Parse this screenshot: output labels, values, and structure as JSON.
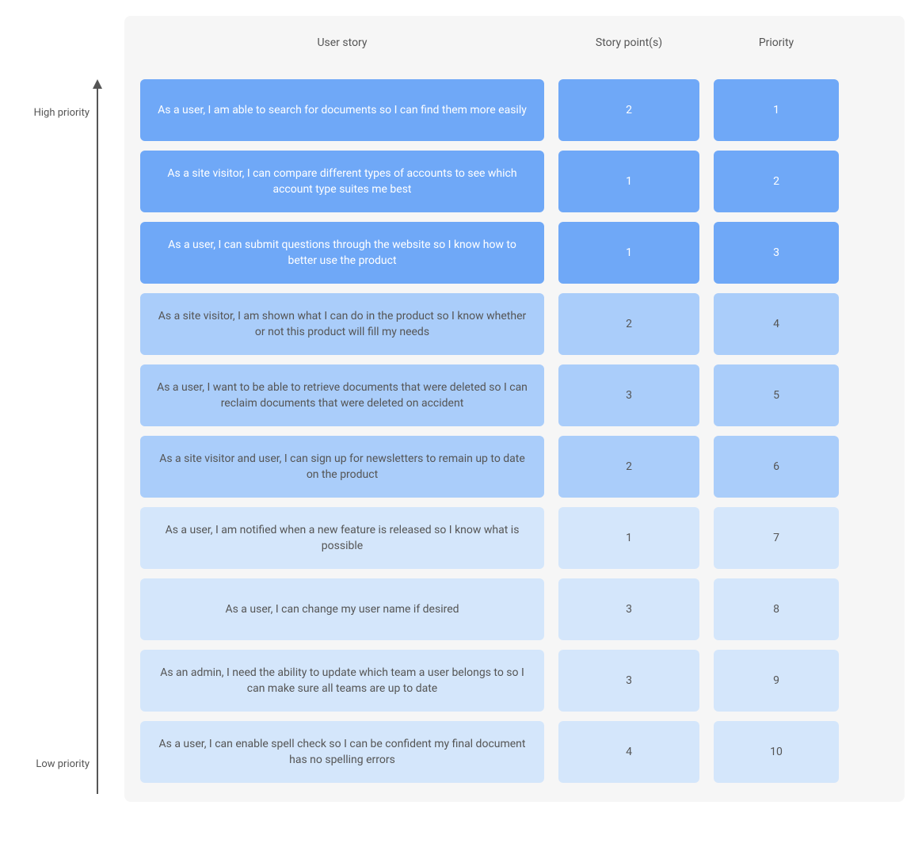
{
  "axis": {
    "high_label": "High priority",
    "low_label": "Low priority"
  },
  "headers": {
    "story": "User story",
    "points": "Story point(s)",
    "priority": "Priority"
  },
  "colors": {
    "tier_high": "#6fa8f7",
    "tier_mid": "#aacdfa",
    "tier_low": "#d4e6fb",
    "panel_bg": "#f6f6f6"
  },
  "rows": [
    {
      "story": "As a user, I am able to search for documents so I can find them more easily",
      "points": "2",
      "priority": "1",
      "tier": "high"
    },
    {
      "story": "As a site visitor, I can compare different types of accounts to see which account type suites me best",
      "points": "1",
      "priority": "2",
      "tier": "high"
    },
    {
      "story": "As a user, I can submit questions through the website so I know how to better use the product",
      "points": "1",
      "priority": "3",
      "tier": "high"
    },
    {
      "story": "As a site visitor, I am shown what I can do in the product so I know whether or not this product will fill my needs",
      "points": "2",
      "priority": "4",
      "tier": "mid"
    },
    {
      "story": "As a user, I want to be able to retrieve documents that were deleted so I can reclaim documents that were deleted on accident",
      "points": "3",
      "priority": "5",
      "tier": "mid"
    },
    {
      "story": "As a site visitor and user, I can sign up for newsletters to remain up to date on the product",
      "points": "2",
      "priority": "6",
      "tier": "mid"
    },
    {
      "story": "As a user, I am notified when a new feature is released so I know what is possible",
      "points": "1",
      "priority": "7",
      "tier": "low"
    },
    {
      "story": "As a user, I can change my user name if desired",
      "points": "3",
      "priority": "8",
      "tier": "low"
    },
    {
      "story": "As an admin, I need the ability to update which team a user belongs to so I can make sure all teams are up to date",
      "points": "3",
      "priority": "9",
      "tier": "low"
    },
    {
      "story": "As a user, I can enable spell check so I can be confident my final document has no spelling errors",
      "points": "4",
      "priority": "10",
      "tier": "low"
    }
  ]
}
